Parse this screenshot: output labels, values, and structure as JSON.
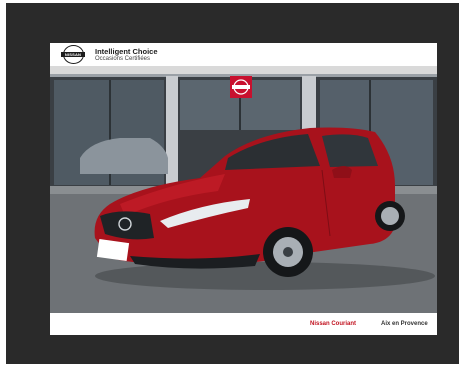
{
  "brand": {
    "logo_text": "NISSAN",
    "title": "Intelligent Choice",
    "subtitle": "Occasions Certifiées"
  },
  "footer": {
    "dealer_name": "Nissan Couriant",
    "dealer_city": "Aix en Provence"
  },
  "colors": {
    "frame": "#2a2a2a",
    "car_body": "#a8121c",
    "dealer_accent": "#c1121f"
  }
}
